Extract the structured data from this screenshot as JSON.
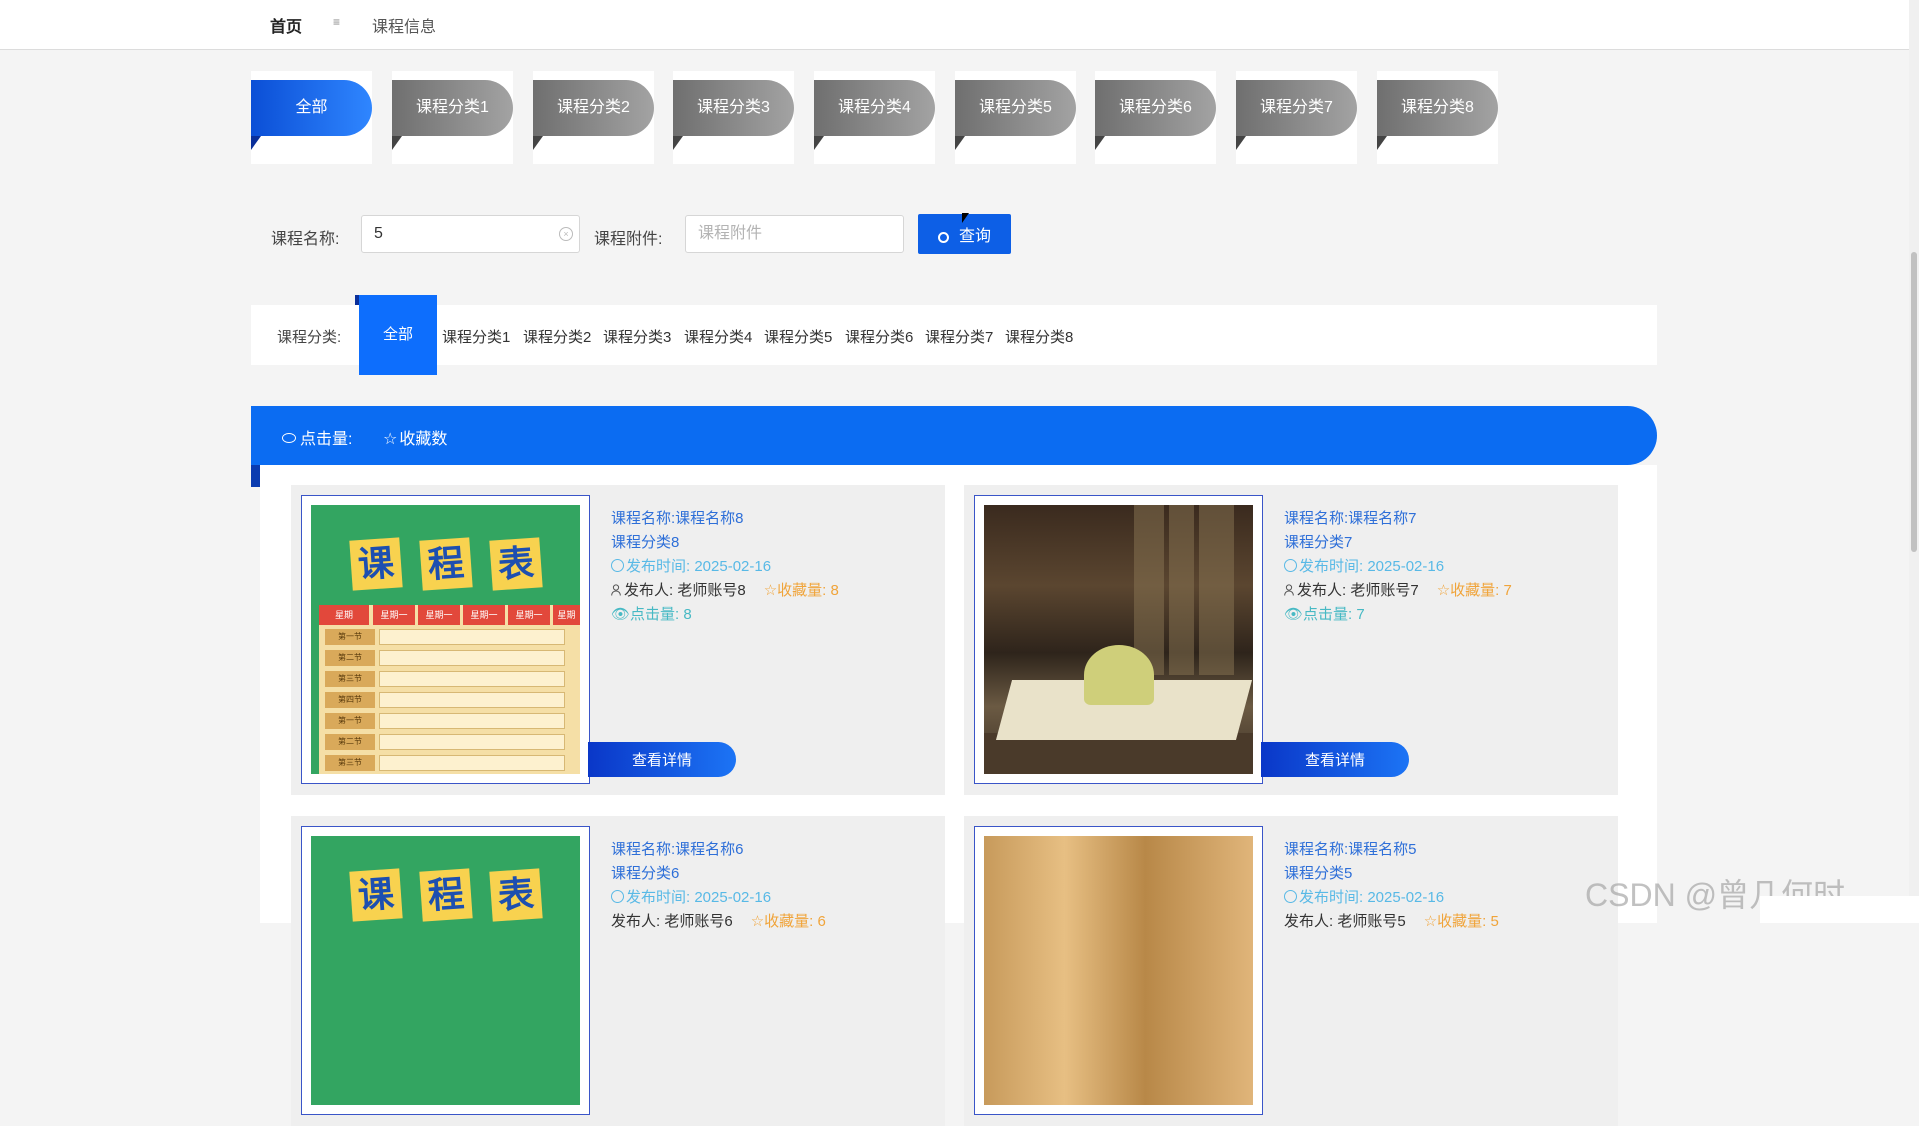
{
  "topbar": {
    "home": "首页",
    "separator": "≡",
    "breadcrumb": "课程信息"
  },
  "category_tabs": [
    "全部",
    "课程分类1",
    "课程分类2",
    "课程分类3",
    "课程分类4",
    "课程分类5",
    "课程分类6",
    "课程分类7",
    "课程分类8"
  ],
  "active_category_tab": "全部",
  "search": {
    "name_label": "课程名称:",
    "name_value": "5",
    "attachment_label": "课程附件:",
    "attachment_placeholder": "课程附件",
    "query_label": "查询"
  },
  "filter": {
    "label": "课程分类:",
    "active": "全部",
    "items": [
      "课程分类1",
      "课程分类2",
      "课程分类3",
      "课程分类4",
      "课程分类5",
      "课程分类6",
      "课程分类7",
      "课程分类8"
    ]
  },
  "sort": {
    "clicks_label": "点击量:",
    "favorites_label": "收藏数"
  },
  "cards": [
    {
      "name": "课程名称:课程名称8",
      "category": "课程分类8",
      "time": "发布时间:  2025-02-16",
      "publisher": "发布人:  老师账号8",
      "favorites": "收藏量:  8",
      "clicks": "点击量:  8",
      "detail": "查看详情",
      "image": "schedule"
    },
    {
      "name": "课程名称:课程名称7",
      "category": "课程分类7",
      "time": "发布时间:  2025-02-16",
      "publisher": "发布人:  老师账号7",
      "favorites": "收藏量:  7",
      "clicks": "点击量:  7",
      "detail": "查看详情",
      "image": "book-photo"
    },
    {
      "name": "课程名称:课程名称6",
      "category": "课程分类6",
      "time": "发布时间:  2025-02-16",
      "publisher": "发布人:  老师账号6",
      "favorites": "收藏量:  6",
      "image": "schedule"
    },
    {
      "name": "课程名称:课程名称5",
      "category": "课程分类5",
      "time": "发布时间:  2025-02-16",
      "publisher": "发布人:  老师账号5",
      "favorites": "收藏量:  5",
      "image": "wood"
    }
  ],
  "schedule_image": {
    "title_chars": [
      "课",
      "程",
      "表"
    ],
    "header": [
      "星期",
      "星期一",
      "星期一",
      "星期一",
      "星期一",
      "星期"
    ],
    "rows": [
      "第一节",
      "第二节",
      "第三节",
      "第四节",
      "第一节",
      "第二节",
      "第三节"
    ]
  },
  "watermark": "CSDN @曾几何时…",
  "colors": {
    "accent": "#0b6cf2",
    "tab_inactive": "#8a8a8a",
    "link": "#2e6fd8",
    "favorite": "#f0a43a"
  }
}
